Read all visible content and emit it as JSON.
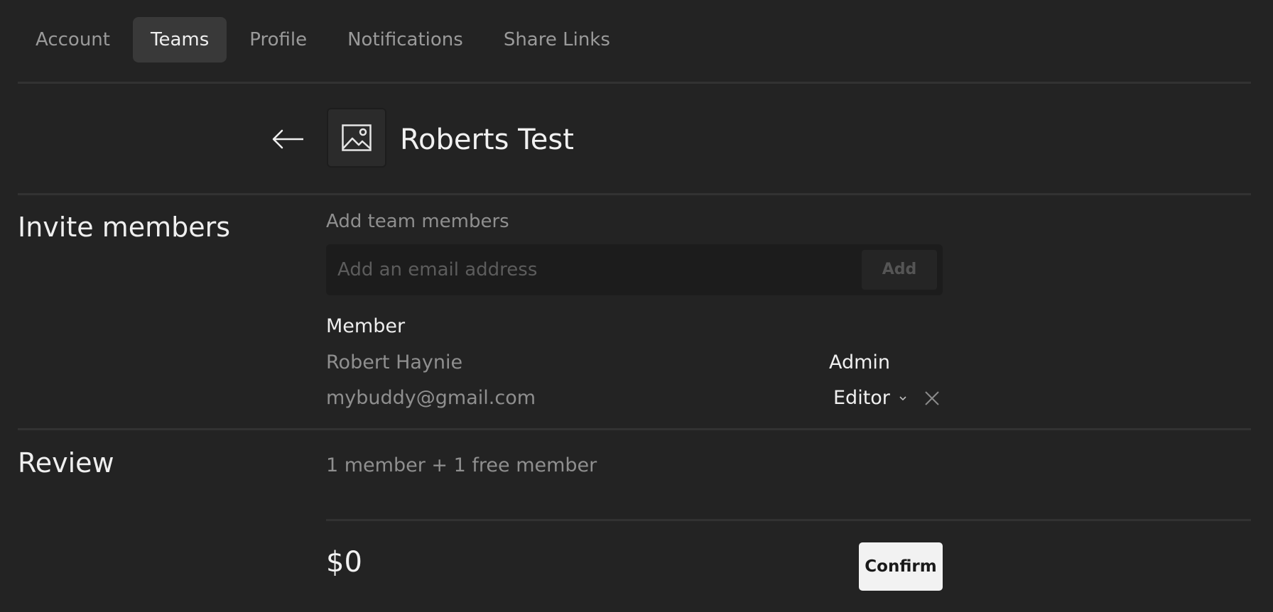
{
  "tabs": [
    {
      "label": "Account",
      "active": false
    },
    {
      "label": "Teams",
      "active": true
    },
    {
      "label": "Profile",
      "active": false
    },
    {
      "label": "Notifications",
      "active": false
    },
    {
      "label": "Share Links",
      "active": false
    }
  ],
  "team": {
    "name": "Roberts Test",
    "avatar_icon": "image-placeholder-icon",
    "back_icon": "arrow-left-icon"
  },
  "invite": {
    "section_title": "Invite members",
    "field_label": "Add team members",
    "email_placeholder": "Add an email address",
    "email_value": "",
    "add_label": "Add"
  },
  "members": {
    "header": "Member",
    "rows": [
      {
        "name": "Robert Haynie",
        "role": "Admin",
        "editable": false
      },
      {
        "name": "mybuddy@gmail.com",
        "role": "Editor",
        "editable": true
      }
    ]
  },
  "review": {
    "section_title": "Review",
    "summary": "1 member + 1 free member",
    "price": "$0",
    "confirm_label": "Confirm"
  },
  "colors": {
    "background": "#232323",
    "divider": "#323232",
    "active_tab": "#393939",
    "confirm_button": "#f2f2f2"
  }
}
